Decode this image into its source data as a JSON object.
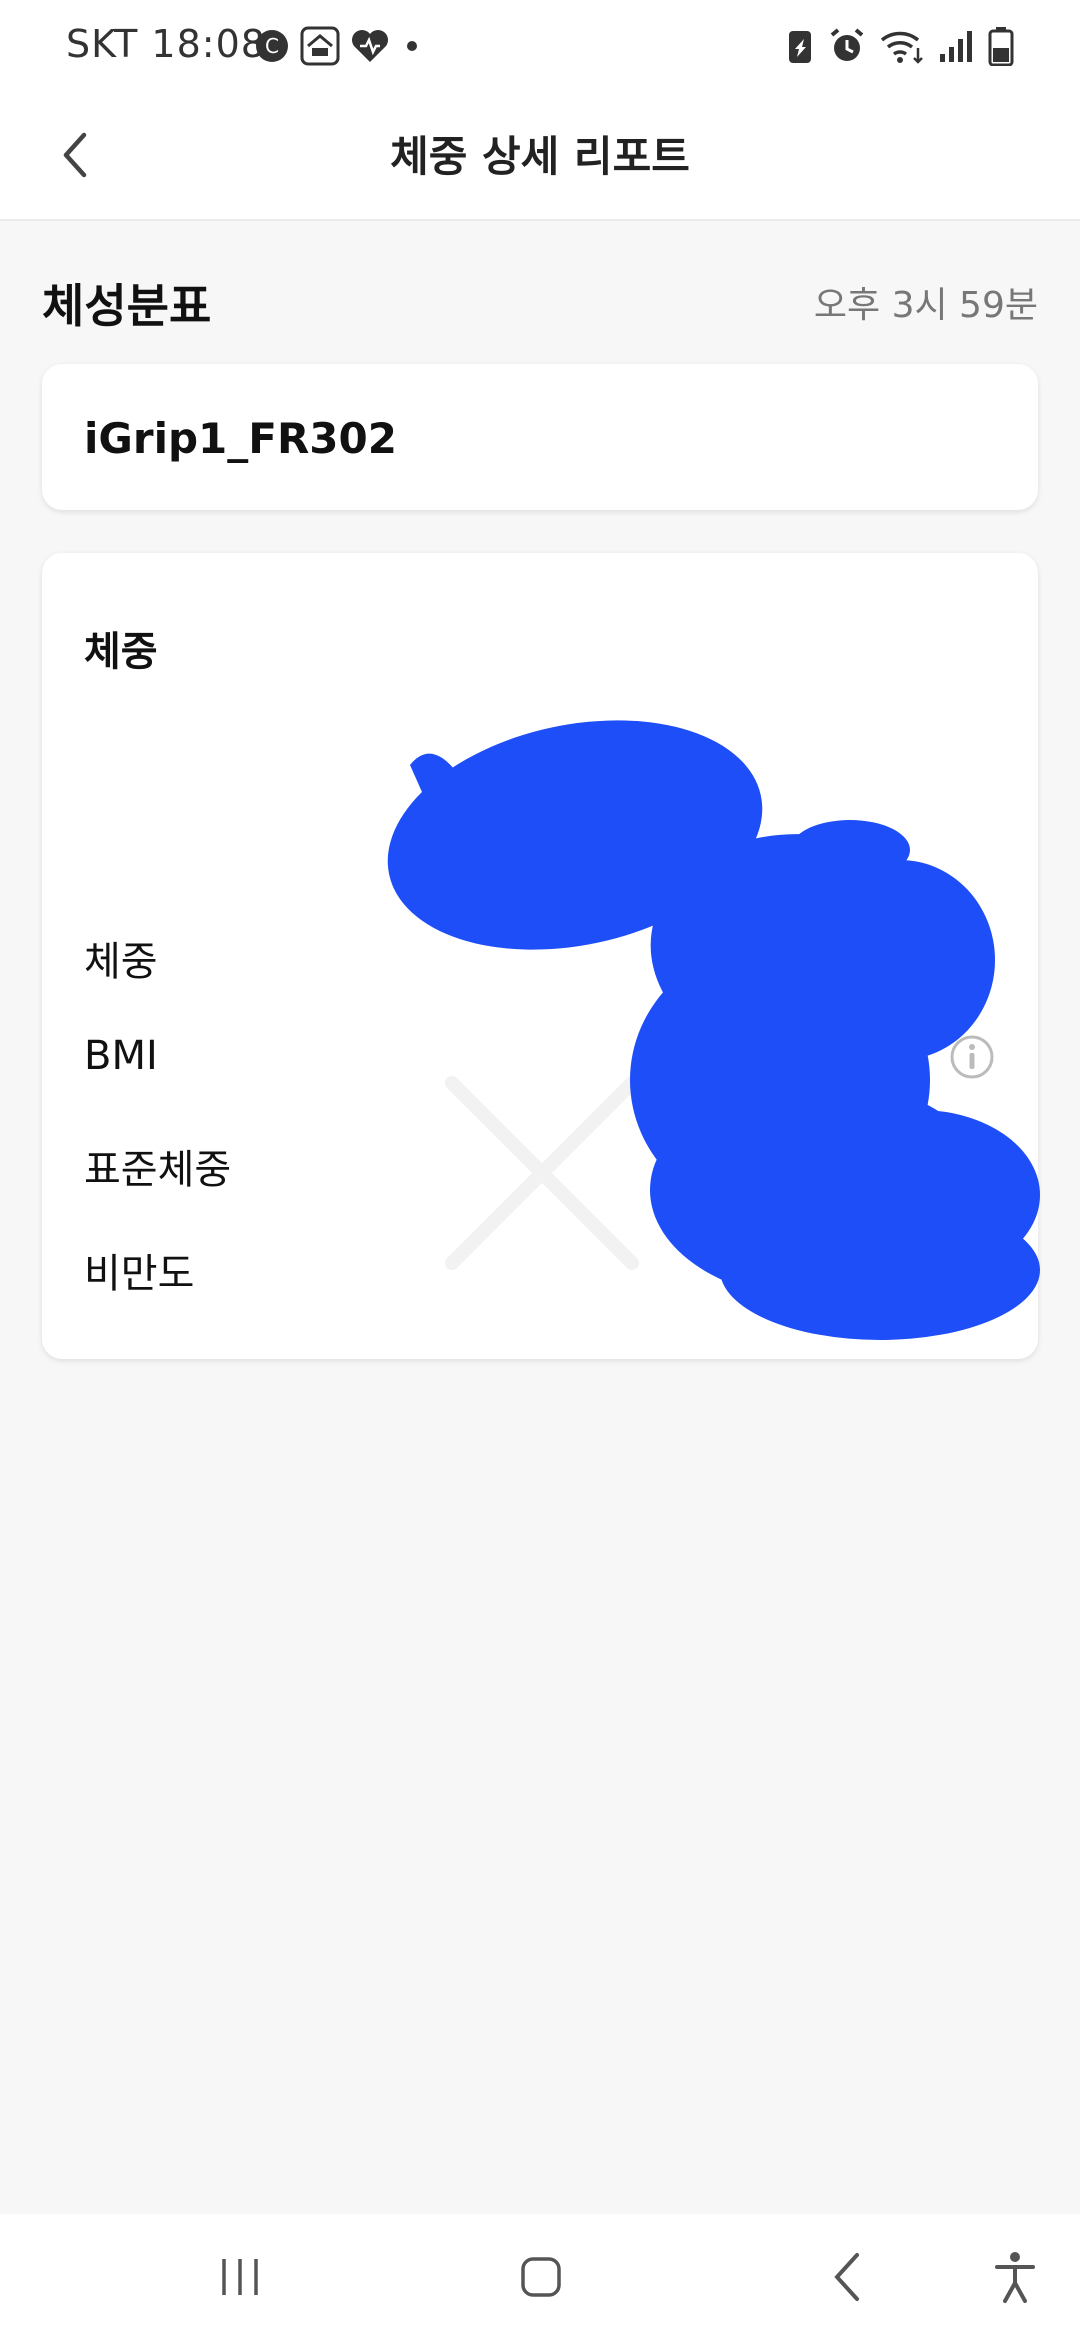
{
  "status_bar": {
    "carrier": "SKT",
    "time": "18:08",
    "left_icons": [
      "c-badge-icon",
      "app-notification-icon",
      "heart-app-icon",
      "dot-icon"
    ],
    "right_icons": [
      "battery-saver-icon",
      "alarm-icon",
      "wifi-icon",
      "signal-icon",
      "battery-icon"
    ]
  },
  "header": {
    "title": "체중 상세 리포트",
    "back_icon": "chevron-left-icon"
  },
  "section": {
    "title": "체성분표",
    "time": "오후 3시 59분"
  },
  "device_card": {
    "device_name": "iGrip1_FR302"
  },
  "weight_card": {
    "title": "체중",
    "metrics": [
      {
        "label": "체중"
      },
      {
        "label": "BMI"
      },
      {
        "label": "표준체중"
      },
      {
        "label": "비만도"
      }
    ],
    "info_icon": "info-icon"
  },
  "colors": {
    "redaction": "#1e4ef7",
    "background": "#f7f7f8",
    "card": "#ffffff"
  },
  "nav_bar": {
    "icons": [
      "recent-apps-icon",
      "home-icon",
      "back-icon",
      "accessibility-icon"
    ]
  }
}
